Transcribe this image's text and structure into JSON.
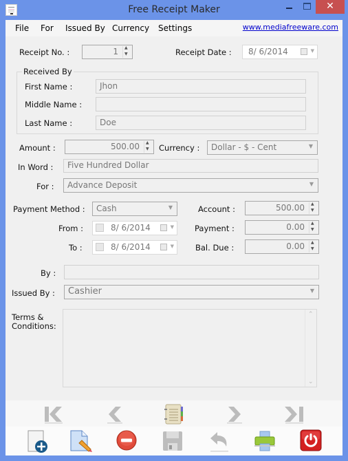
{
  "window": {
    "title": "Free Receipt Maker",
    "controls": {
      "minimize": "minimize",
      "maximize": "maximize",
      "close": "✕"
    }
  },
  "menu": {
    "items": [
      "File",
      "For",
      "Issued By",
      "Currency",
      "Settings"
    ],
    "link": "www.mediafreeware.com"
  },
  "receipt": {
    "number_label": "Receipt No.   :",
    "number_value": "1",
    "date_label": "Receipt Date :",
    "date_value": "8/  6/2014"
  },
  "received_by": {
    "group_title": "Received By",
    "first_name_label": "First Name    :",
    "first_name_value": "Jhon",
    "middle_name_label": "Middle Name :",
    "middle_name_value": "",
    "last_name_label": "Last Name    :",
    "last_name_value": "Doe"
  },
  "amount": {
    "label": "Amount :",
    "value": "500.00",
    "currency_label": "Currency :",
    "currency_value": "Dollar - $ - Cent",
    "in_word_label": "In Word :",
    "in_word_value": "Five Hundred  Dollar",
    "for_label": "For :",
    "for_value": "Advance Deposit"
  },
  "payment": {
    "method_label": "Payment Method :",
    "method_value": "Cash",
    "from_label": "From :",
    "from_value": "8/  6/2014",
    "to_label": "To :",
    "to_value": "8/  6/2014",
    "account_label": "Account :",
    "account_value": "500.00",
    "payment_label": "Payment :",
    "payment_value": "0.00",
    "bal_due_label": "Bal. Due :",
    "bal_due_value": "0.00"
  },
  "issuer": {
    "by_label": "By :",
    "by_value": "",
    "issued_by_label": "Issued By :",
    "issued_by_value": "Cashier",
    "terms_label_line1": "Terms &",
    "terms_label_line2": "Conditions:",
    "terms_value": ""
  },
  "navigation": {
    "first": "first-record",
    "previous": "previous-record",
    "list": "records-list",
    "next": "next-record",
    "last": "last-record"
  },
  "toolbar": {
    "new": "new-receipt",
    "edit": "edit-receipt",
    "delete": "delete-receipt",
    "save": "save-receipt",
    "undo": "undo",
    "print": "print",
    "exit": "exit"
  }
}
